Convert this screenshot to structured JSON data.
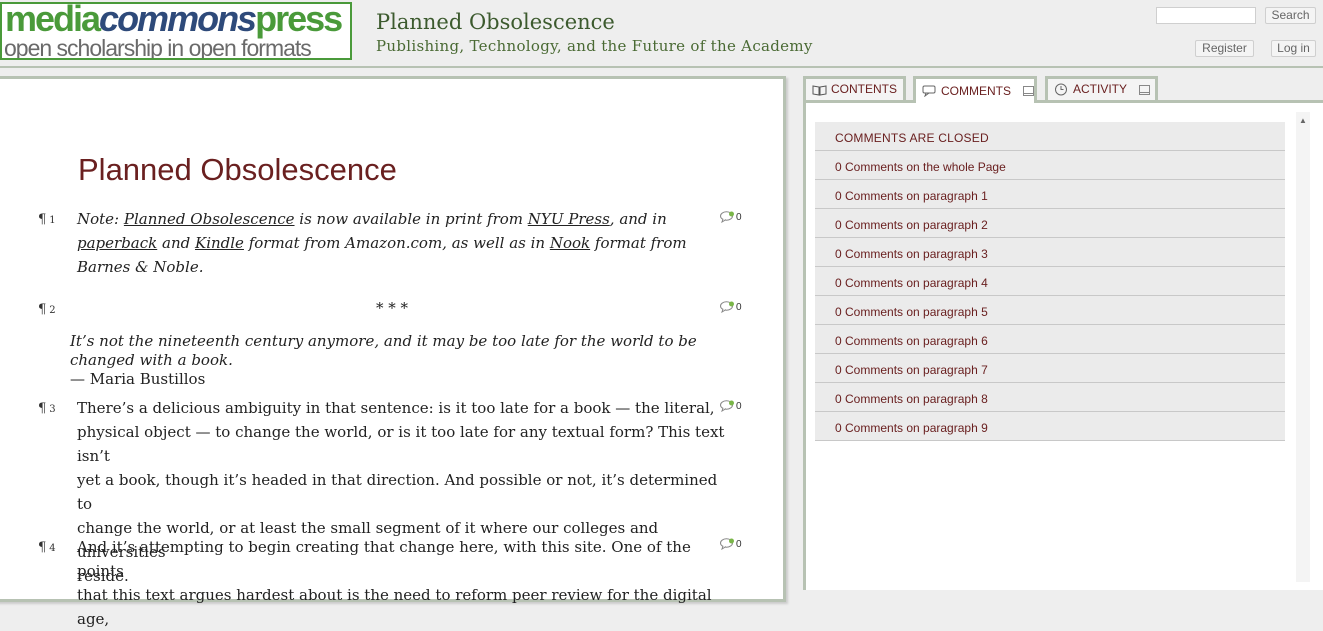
{
  "header": {
    "logo": {
      "line1a": "media",
      "line1b": "commons",
      "line1c": "press",
      "line2": "open scholarship in open formats"
    },
    "site_title": "Planned Obsolescence",
    "site_subtitle": "Publishing, Technology, and the Future of the Academy",
    "search_placeholder": "",
    "search_button": "Search",
    "register_button": "Register",
    "login_button": "Log in"
  },
  "article": {
    "title": "Planned Obsolescence",
    "paragraphs": [
      {
        "num": "1",
        "comments": "0",
        "segments": {
          "s1": "Note: ",
          "link1": "Planned Obsolescence",
          "s2": " is now available in print from ",
          "link2": "NYU Press",
          "s3": ", and in",
          "link3": "paperback",
          "s4": " and ",
          "link4": "Kindle",
          "s5": " format from Amazon.com, as well as in ",
          "link5": "Nook",
          "s6": " format from",
          "s7": "Barnes & Noble."
        }
      },
      {
        "num": "2",
        "comments": "0",
        "text": "* * *"
      },
      {
        "num": "3",
        "comments": "0",
        "lines": [
          "There’s a delicious ambiguity in that sentence: is it too late for a book — the literal,",
          "physical object — to change the world, or is it too late for any textual form? This text isn’t",
          "yet a book, though it’s headed in that direction. And possible or not, it’s determined to",
          "change the world, or at least the small segment of it where our colleges and universities",
          "reside."
        ]
      },
      {
        "num": "4",
        "comments": "0",
        "lines": [
          "And it’s attempting to begin creating that change here, with this site. One of the points",
          "that this text argues hardest about is the need to reform peer review for the digital age,"
        ]
      }
    ],
    "quote": {
      "line1": "It’s not the nineteenth century anymore, and it may be too late for the world to be",
      "line2": "changed with a book.",
      "attribution": "— Maria Bustillos"
    },
    "para_mark": "¶"
  },
  "sidebar": {
    "tabs": [
      {
        "label": "Contents"
      },
      {
        "label": "Comments"
      },
      {
        "label": "Activity"
      }
    ],
    "comment_rows": [
      "COMMENTS ARE CLOSED",
      "0 Comments on the whole Page",
      "0 Comments on paragraph 1",
      "0 Comments on paragraph 2",
      "0 Comments on paragraph 3",
      "0 Comments on paragraph 4",
      "0 Comments on paragraph 5",
      "0 Comments on paragraph 6",
      "0 Comments on paragraph 7",
      "0 Comments on paragraph 8",
      "0 Comments on paragraph 9"
    ]
  },
  "colors": {
    "brand_green": "#4a9a3a",
    "brand_blue": "#2e4a7a",
    "title_maroon": "#6a2020",
    "frame_border": "#b7c2b3"
  }
}
